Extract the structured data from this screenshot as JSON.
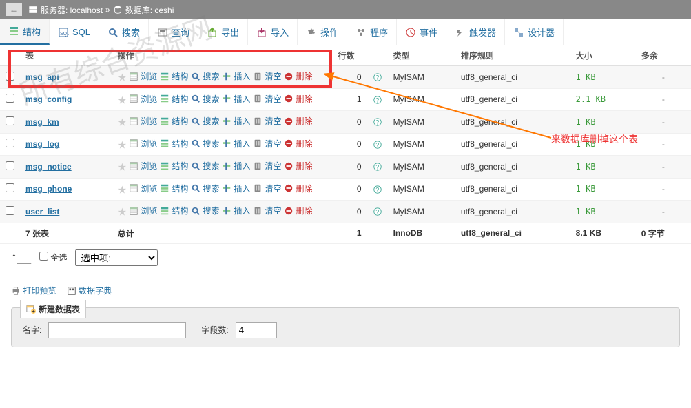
{
  "breadcrumb": {
    "server_label": "服务器: localhost",
    "db_label": "数据库: ceshi",
    "sep": "»"
  },
  "tabs": {
    "structure": "结构",
    "sql": "SQL",
    "search": "搜索",
    "query": "查询",
    "export": "导出",
    "import": "导入",
    "operations": "操作",
    "routines": "程序",
    "events": "事件",
    "triggers": "触发器",
    "designer": "设计器"
  },
  "thead": {
    "table": "表",
    "action": "操作",
    "rows": "行数",
    "type": "类型",
    "collation": "排序规则",
    "size": "大小",
    "overhead": "多余"
  },
  "ops": {
    "browse": "浏览",
    "structure": "结构",
    "search": "搜索",
    "insert": "插入",
    "empty": "清空",
    "drop": "删除"
  },
  "rows": [
    {
      "name": "msg_api",
      "rows": 0,
      "engine": "MyISAM",
      "coll": "utf8_general_ci",
      "size": "1 KB",
      "oh": "-"
    },
    {
      "name": "msg_config",
      "rows": 1,
      "engine": "MyISAM",
      "coll": "utf8_general_ci",
      "size": "2.1 KB",
      "oh": "-"
    },
    {
      "name": "msg_km",
      "rows": 0,
      "engine": "MyISAM",
      "coll": "utf8_general_ci",
      "size": "1 KB",
      "oh": "-"
    },
    {
      "name": "msg_log",
      "rows": 0,
      "engine": "MyISAM",
      "coll": "utf8_general_ci",
      "size": "1 KB",
      "oh": "-"
    },
    {
      "name": "msg_notice",
      "rows": 0,
      "engine": "MyISAM",
      "coll": "utf8_general_ci",
      "size": "1 KB",
      "oh": "-"
    },
    {
      "name": "msg_phone",
      "rows": 0,
      "engine": "MyISAM",
      "coll": "utf8_general_ci",
      "size": "1 KB",
      "oh": "-"
    },
    {
      "name": "user_list",
      "rows": 0,
      "engine": "MyISAM",
      "coll": "utf8_general_ci",
      "size": "1 KB",
      "oh": "-"
    }
  ],
  "sum": {
    "label": "7 张表",
    "total": "总计",
    "rows": 1,
    "engine": "InnoDB",
    "coll": "utf8_general_ci",
    "size": "8.1 KB",
    "oh": "0 字节"
  },
  "footer": {
    "check_all": "全选",
    "with_selected": "选中项:"
  },
  "links": {
    "print": "打印预览",
    "dict": "数据字典"
  },
  "create": {
    "legend": "新建数据表",
    "name_label": "名字:",
    "cols_label": "字段数:",
    "cols_value": "4"
  },
  "annotation": "来数据库删掉这个表",
  "watermark": "所有综合资源网"
}
